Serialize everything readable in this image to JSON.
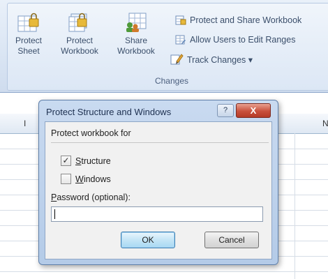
{
  "ribbon": {
    "buttons": [
      {
        "label": "Protect\nSheet",
        "icon": "protect-sheet-icon"
      },
      {
        "label": "Protect\nWorkbook",
        "icon": "protect-workbook-icon"
      },
      {
        "label": "Share\nWorkbook",
        "icon": "share-workbook-icon"
      }
    ],
    "small_buttons": [
      {
        "label": "Protect and Share Workbook",
        "icon": "protect-share-icon"
      },
      {
        "label": "Allow Users to Edit Ranges",
        "icon": "edit-ranges-icon"
      },
      {
        "label": "Track Changes ▾",
        "icon": "track-changes-icon"
      }
    ],
    "group_label": "Changes"
  },
  "sheet": {
    "col_letters": [
      "I",
      "N"
    ]
  },
  "dialog": {
    "title": "Protect Structure and Windows",
    "help_label": "?",
    "close_label": "X",
    "section_label": "Protect workbook for",
    "structure": {
      "label": "Structure",
      "checked": true
    },
    "windows": {
      "label": "Windows",
      "checked": false
    },
    "password_label": "Password (optional):",
    "password_value": "",
    "ok_label": "OK",
    "cancel_label": "Cancel"
  }
}
